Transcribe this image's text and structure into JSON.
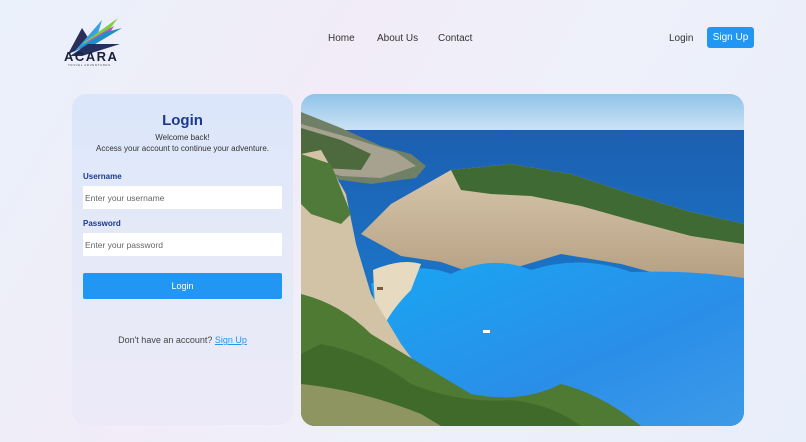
{
  "brand": {
    "name": "ACARA",
    "tagline": "TRAVEL ADVENTURES"
  },
  "nav": {
    "home": "Home",
    "about": "About Us",
    "contact": "Contact",
    "login": "Login",
    "signup": "Sign Up"
  },
  "form": {
    "title": "Login",
    "welcome": "Welcome back!",
    "subtitle": "Access your account to continue your adventure.",
    "username_label": "Username",
    "username_placeholder": "Enter your username",
    "password_label": "Password",
    "password_placeholder": "Enter your password",
    "submit_label": "Login",
    "no_account_text": "Don't have an account?",
    "signup_link": "Sign Up"
  },
  "colors": {
    "accent": "#2196f3",
    "heading": "#1a3a8f"
  }
}
